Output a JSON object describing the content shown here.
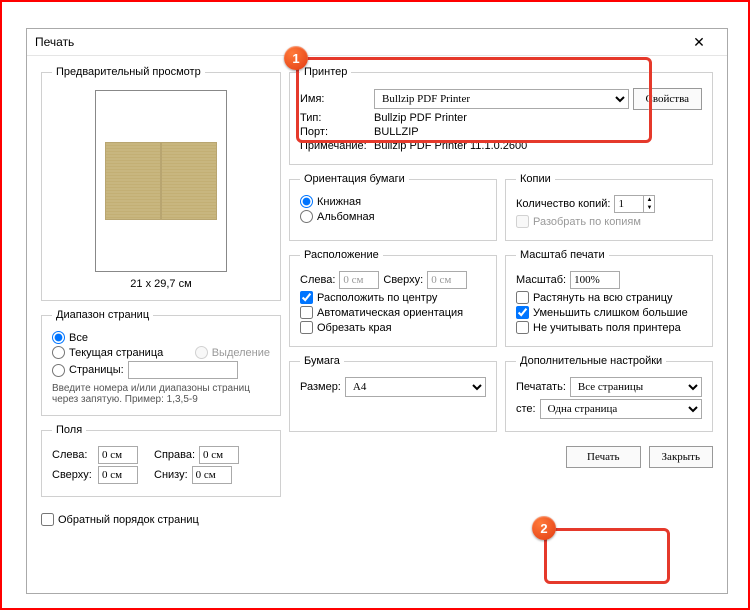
{
  "title": "Печать",
  "close_glyph": "✕",
  "preview": {
    "legend": "Предварительный просмотр",
    "dim": "21 x 29,7 см"
  },
  "printer": {
    "legend": "Принтер",
    "name_lbl": "Имя:",
    "name_val": "Bullzip PDF Printer",
    "btn": "Свойства",
    "type_lbl": "Тип:",
    "type_val": "Bullzip PDF Printer",
    "port_lbl": "Порт:",
    "port_val": "BULLZIP",
    "note_lbl": "Примечание:",
    "note_val": "Bullzip PDF Printer 11.1.0.2600"
  },
  "range": {
    "legend": "Диапазон страниц",
    "all": "Все",
    "current": "Текущая страница",
    "selection": "Выделение",
    "pages": "Страницы:",
    "hint": "Введите номера и/или диапазоны страниц через запятую. Пример: 1,3,5-9"
  },
  "orient": {
    "legend": "Ориентация бумаги",
    "portrait": "Книжная",
    "landscape": "Альбомная"
  },
  "copies": {
    "legend": "Копии",
    "count_lbl": "Количество копий:",
    "count_val": "1",
    "collate": "Разобрать по копиям"
  },
  "layout": {
    "legend": "Расположение",
    "left": "Слева:",
    "left_val": "0 см",
    "top": "Сверху:",
    "top_val": "0 см",
    "center": "Расположить по центру",
    "auto": "Автоматическая ориентация",
    "crop": "Обрезать края"
  },
  "scale": {
    "legend": "Масштаб печати",
    "lbl": "Масштаб:",
    "val": "100%",
    "fit": "Растянуть на всю страницу",
    "shrink": "Уменьшить слишком большие",
    "ignore": "Не учитывать поля принтера"
  },
  "margins": {
    "legend": "Поля",
    "left": "Слева:",
    "right": "Справа:",
    "top": "Сверху:",
    "bottom": "Снизу:",
    "v": "0 см"
  },
  "paper": {
    "legend": "Бумага",
    "size": "Размер:",
    "size_val": "A4"
  },
  "extra": {
    "legend": "Дополнительные настройки",
    "print": "Печатать:",
    "print_val": "Все страницы",
    "per": "сте:",
    "per_val": "Одна страница"
  },
  "reverse": "Обратный порядок страниц",
  "btn_print": "Печать",
  "btn_close": "Закрыть",
  "badge1": "1",
  "badge2": "2"
}
